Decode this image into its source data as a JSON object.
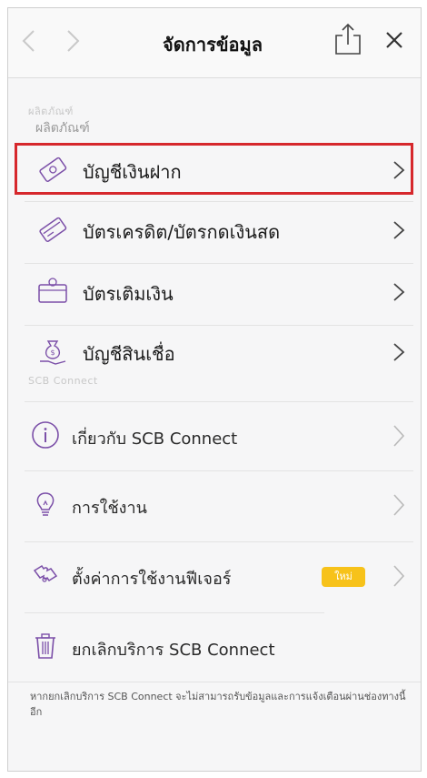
{
  "header": {
    "title": "จัดการข้อมูล"
  },
  "sections": {
    "products_ghost": "ผลิตภัณฑ์",
    "products": "ผลิตภัณฑ์",
    "connect_ghost": "SCB Connect"
  },
  "products": [
    {
      "label": "บัญชีเงินฝาก",
      "icon": "savings-card-icon"
    },
    {
      "label": "บัตรเครดิต/บัตรกดเงินสด",
      "icon": "credit-card-icon"
    },
    {
      "label": "บัตรเติมเงิน",
      "icon": "prepaid-card-icon"
    },
    {
      "label": "บัญชีสินเชื่อ",
      "icon": "loan-money-bag-icon"
    }
  ],
  "connect": [
    {
      "label": "เกี่ยวกับ SCB Connect",
      "icon": "info-icon"
    },
    {
      "label": "การใช้งาน",
      "icon": "lightbulb-icon"
    },
    {
      "label": "ตั้งค่าการใช้งานฟีเจอร์",
      "icon": "puzzle-settings-icon",
      "badge": "ใหม่"
    },
    {
      "label": "ยกเลิกบริการ SCB Connect",
      "icon": "trash-icon"
    }
  ],
  "footer_note": "หากยกเลิกบริการ SCB Connect จะไม่สามารถรับข้อมูลและการแจ้งเตือนผ่านช่องทางนี้อีก",
  "colors": {
    "accent_purple": "#7b4fa8",
    "highlight_red": "#d6272c",
    "badge_yellow": "#f7c21a"
  }
}
